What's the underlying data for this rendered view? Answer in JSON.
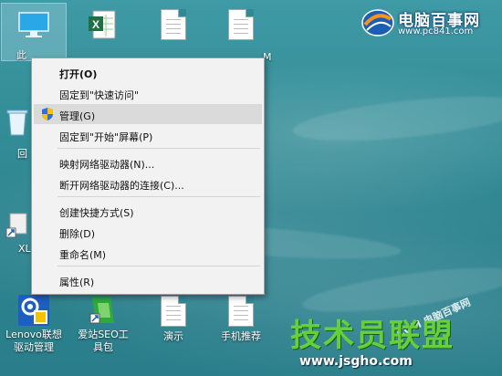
{
  "desktop": {
    "icons": [
      {
        "label": "此",
        "name": "this-pc"
      },
      {
        "label": "",
        "name": "excel-file"
      },
      {
        "label": "",
        "name": "text-file-1"
      },
      {
        "label": "",
        "name": "text-file-2"
      },
      {
        "label": "M",
        "name": "text-file-3"
      },
      {
        "label": "回",
        "name": "recycle-bin"
      },
      {
        "label": "XL",
        "name": "xl-shortcut"
      },
      {
        "label": "Lenovo联想\n驱动管理",
        "name": "lenovo-driver-manager"
      },
      {
        "label": "爱站SEO工\n具包",
        "name": "aizhan-seo-toolkit"
      },
      {
        "label": "演示",
        "name": "presentation-file"
      },
      {
        "label": "手机推荐",
        "name": "phone-recommend-file"
      }
    ]
  },
  "context_menu": {
    "items": [
      {
        "label": "打开(O)",
        "bold": true
      },
      {
        "label": "固定到\"快速访问\""
      },
      {
        "label": "管理(G)",
        "icon": "uac-shield-icon",
        "highlighted": true
      },
      {
        "label": "固定到\"开始\"屏幕(P)"
      },
      {
        "label": "映射网络驱动器(N)..."
      },
      {
        "label": "断开网络驱动器的连接(C)..."
      },
      {
        "label": "创建快捷方式(S)"
      },
      {
        "label": "删除(D)"
      },
      {
        "label": "重命名(M)"
      },
      {
        "label": "属性(R)"
      }
    ]
  },
  "watermarks": {
    "site_name": "电脑百事网",
    "site_url": "www.pc841.com",
    "brand_big": "技术员联盟",
    "brand_url": "www.jsgho.com",
    "mid_text": ".COM 电脑百事网"
  },
  "colors": {
    "desktop_bg": "#2f8a95",
    "menu_bg": "#f2f2f2",
    "menu_highlight": "#dadada"
  }
}
